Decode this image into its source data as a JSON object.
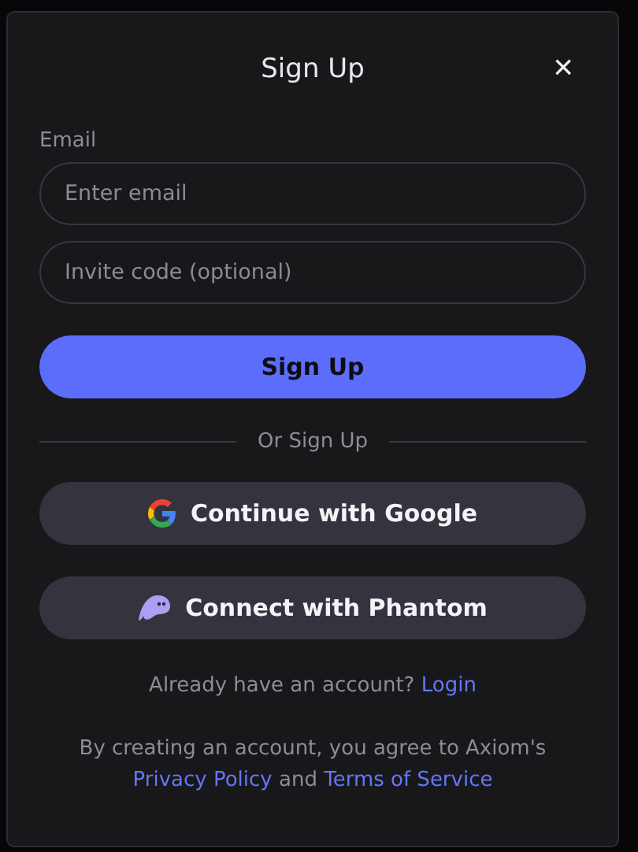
{
  "dialog": {
    "title": "Sign Up",
    "close": "×"
  },
  "fields": [
    {
      "label": "Email",
      "placeholder": "Enter email"
    },
    {
      "placeholder": "Invite code (optional)"
    }
  ],
  "submit": "Sign Up",
  "divider": "Or Sign Up",
  "providers": [
    {
      "kind": "google",
      "label": "Continue with Google"
    },
    {
      "kind": "phantom",
      "label": "Connect with Phantom"
    }
  ],
  "login_prompt": {
    "text": "Already have an account?",
    "link": "Login"
  },
  "legal": {
    "text": "By creating an account, you agree to Axiom's",
    "link_1": "Privacy Policy",
    "joiner": "and",
    "link_2": "Terms of Service"
  }
}
